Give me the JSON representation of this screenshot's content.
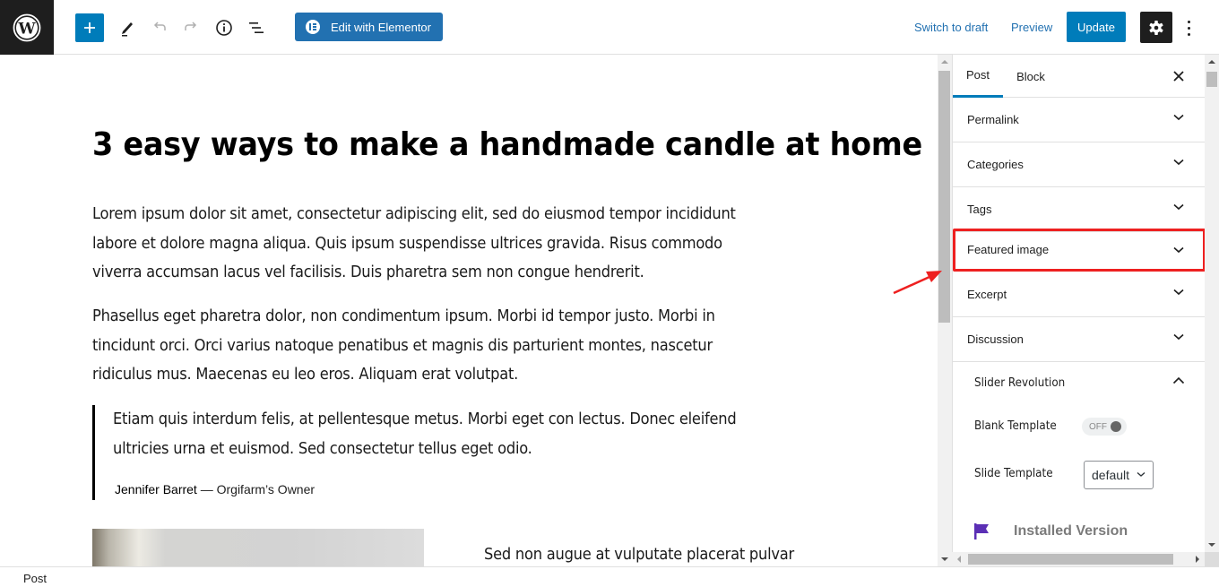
{
  "header": {
    "logo": "wordpress-logo",
    "toolbar": {
      "add_block": "plus-icon",
      "tools": "pencil-icon",
      "undo": "undo-icon",
      "redo": "redo-icon",
      "details": "info-icon",
      "list_view": "list-view-icon"
    },
    "elementor_label": "Edit with Elementor",
    "switch_to_draft": "Switch to draft",
    "preview": "Preview",
    "update": "Update"
  },
  "post": {
    "title": "3 easy ways to make a handmade candle at home",
    "paragraph1": [
      "Lorem ipsum dolor sit amet, consectetur adipiscing elit, sed do eiusmod tempor incididunt",
      "labore et dolore magna aliqua. Quis ipsum suspendisse ultrices gravida. Risus commodo",
      "viverra accumsan lacus vel facilisis. Duis pharetra sem non congue hendrerit."
    ],
    "paragraph2": [
      "Phasellus eget pharetra dolor, non condimentum ipsum. Morbi id tempor justo. Morbi in",
      "tincidunt orci. Orci varius natoque penatibus et magnis dis parturient montes, nascetur",
      "ridiculus mus. Maecenas eu leo eros. Aliquam erat volutpat."
    ],
    "quote": {
      "lines": [
        "Etiam quis interdum felis, at pellentesque metus. Morbi eget con lectus. Donec eleifend",
        "ultricies urna et euismod. Sed consectetur tellus eget odio."
      ],
      "author": "Jennifer Barret",
      "role": " — Orgifarm’s Owner"
    },
    "side_text": "Sed non augue at vulputate placerat pulvar"
  },
  "sidebar": {
    "tabs": [
      {
        "label": "Post",
        "active": true
      },
      {
        "label": "Block",
        "active": false
      }
    ],
    "panels": [
      {
        "label": "Permalink"
      },
      {
        "label": "Categories"
      },
      {
        "label": "Tags"
      },
      {
        "label": "Featured image",
        "highlighted": true
      },
      {
        "label": "Excerpt"
      },
      {
        "label": "Discussion"
      }
    ],
    "slider_revolution": {
      "title": "Slider Revolution",
      "blank_template_label": "Blank Template",
      "blank_template_state": "OFF",
      "slide_template_label": "Slide Template",
      "slide_template_value": "default",
      "installed_version_label": "Installed Version"
    }
  },
  "footer": {
    "breadcrumb": "Post"
  },
  "colors": {
    "accent": "#007cba",
    "elementor": "#2271b1",
    "highlight": "#ee2020",
    "flag": "#5b2fb5"
  }
}
